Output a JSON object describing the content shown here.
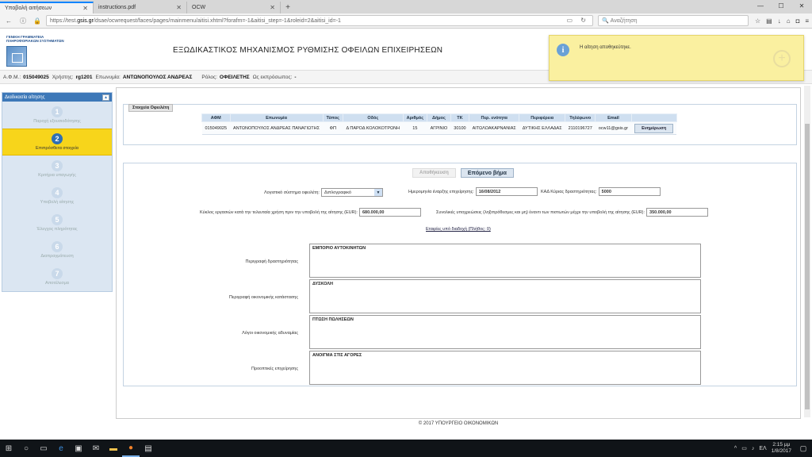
{
  "browser": {
    "tabs": [
      {
        "label": "Υποβολή αιτήσεων",
        "active": true
      },
      {
        "label": "instructions.pdf",
        "active": false
      },
      {
        "label": "OCW",
        "active": false
      }
    ],
    "url_prefix": "https://test.",
    "url_host": "gsis.gr",
    "url_rest": "/dsae/ocwrequest/faces/pages/mainmenu/aitisi.xhtml?forafm=-1&aitisi_step=-1&roleid=2&aitisi_id=-1",
    "search_placeholder": "Αναζήτηση"
  },
  "header": {
    "logo_line1": "ΓΕΝΙΚΗ ΓΡΑΜΜΑΤΕΙΑ",
    "logo_line2": "ΠΛΗΡΟΦΟΡΙΑΚΩΝ ΣΥΣΤΗΜΑΤΩΝ",
    "title": "ΕΞΩΔΙΚΑΣΤΙΚΟΣ ΜΗΧΑΝΙΣΜΟΣ ΡΥΘΜΙΣΗΣ ΟΦΕΙΛΩΝ ΕΠΙΧΕΙΡΗΣΕΩΝ"
  },
  "userbar": {
    "afm_label": "Α.Φ.Μ.:",
    "afm": "015049025",
    "user_label": "Χρήστης:",
    "user": "rg1201",
    "name_label": "Επωνυμία:",
    "name": "ΑΝΤΩΝΟΠΟΥΛΟΣ ΑΝΔΡΕΑΣ",
    "role_label": "Ρόλος:",
    "role": "ΟΦΕΙΛΕΤΗΣ",
    "proxy_label": "Ως εκπρόσωπος:",
    "proxy": "-"
  },
  "sidebar": {
    "title": "Διαδικασία αίτησης",
    "collapse": "▴",
    "steps": [
      {
        "num": "1",
        "label": "Παροχή εξουσιοδότησης"
      },
      {
        "num": "2",
        "label": "Επιπρόσθετα στοιχεία"
      },
      {
        "num": "3",
        "label": "Κριτήρια υπαγωγής"
      },
      {
        "num": "4",
        "label": "Υποβολή αίτησης"
      },
      {
        "num": "5",
        "label": "Έλεγχος πληρότητας"
      },
      {
        "num": "6",
        "label": "Διαπραγμάτευση"
      },
      {
        "num": "7",
        "label": "Αποτέλεσμα"
      }
    ]
  },
  "debtor_panel": {
    "tab_label": "Στοιχεία Οφειλέτη",
    "columns": [
      "ΑΦΜ",
      "Επωνυμία",
      "Τύπος",
      "Οδός",
      "Αριθμός",
      "Δήμος",
      "ΤΚ",
      "Περ. ενότητα",
      "Περιφέρεια",
      "Τηλέφωνο",
      "Email"
    ],
    "row": [
      "015049025",
      "ΑΝΤΩΝΟΠΟΥΛΟΣ ΑΝΔΡΕΑΣ ΠΑΝΑΓΙΩΤΗΣ",
      "ΦΠ",
      "Δ ΠΑΡΟΔ ΚΟΛΟΚΟΤΡΩΝΗ",
      "15",
      "ΑΓΡΙΝΙΟ",
      "30100",
      "ΑΙΤΩΛΟΑΚΑΡΝΑΝΙΑΣ",
      "ΔΥΤΙΚΗΣ ΕΛΛΑΔΑΣ",
      "2110196727",
      "ocw11@gsis.gr"
    ],
    "update_button": "Ενημέρωση"
  },
  "form": {
    "save_button": "Αποθήκευση",
    "next_button": "Επόμενο βήμα",
    "accounting_label": "Λογιστικό σύστημα οφειλέτη:",
    "accounting_value": "Διπλογραφικό",
    "start_date_label": "Ημερομηνία έναρξης επιχείρησης:",
    "start_date_value": "16/08/2012",
    "kad_label": "ΚΑΔ Κύριας δραστηριότητας:",
    "kad_value": "5000",
    "turnover_label": "Κύκλος εργασιών κατά την τελευταία χρήση πριν την υποβολή της αίτησης (EUR):",
    "turnover_value": "680.000,00",
    "liabilities_label": "Συνολικές υποχρεώσεις (ληξιπρόθεσμες και μη) έναντι των πιστωτών μέχρι την υποβολή της αίτησης (EUR):",
    "liabilities_value": "350.000,00",
    "partners_link": "Εταιρίες υπό διαδοχή (Πλήθος: 0)",
    "activity_label": "Περιγραφή δραστηριότητας",
    "activity_value": "ΕΜΠΟΡΙΟ ΑΥΤΟΚΙΝΗΤΩΝ",
    "financial_label": "Περιγραφή οικονομικής κατάστασης",
    "financial_value": "ΔΥΣΚΟΛΗ",
    "reasons_label": "Λόγοι οικονομικής αδυναμίας",
    "reasons_value": "ΠΤΩΣΗ ΠΩΛΗΣΕΩΝ",
    "prospects_label": "Προοπτικές επιχείρησης",
    "prospects_value": "ΑΝΟΙΓΜΑ ΣΤΙΣ ΑΓΟΡΕΣ"
  },
  "notification": {
    "message": "Η αίτηση αποθηκεύτηκε."
  },
  "footer": {
    "text": "© 2017 ΥΠΟΥΡΓΕΙΟ ΟΙΚΟΝΟΜΙΚΩΝ"
  },
  "taskbar": {
    "lang": "ΕΛ",
    "time": "2:15 μμ",
    "date": "1/8/2017"
  }
}
